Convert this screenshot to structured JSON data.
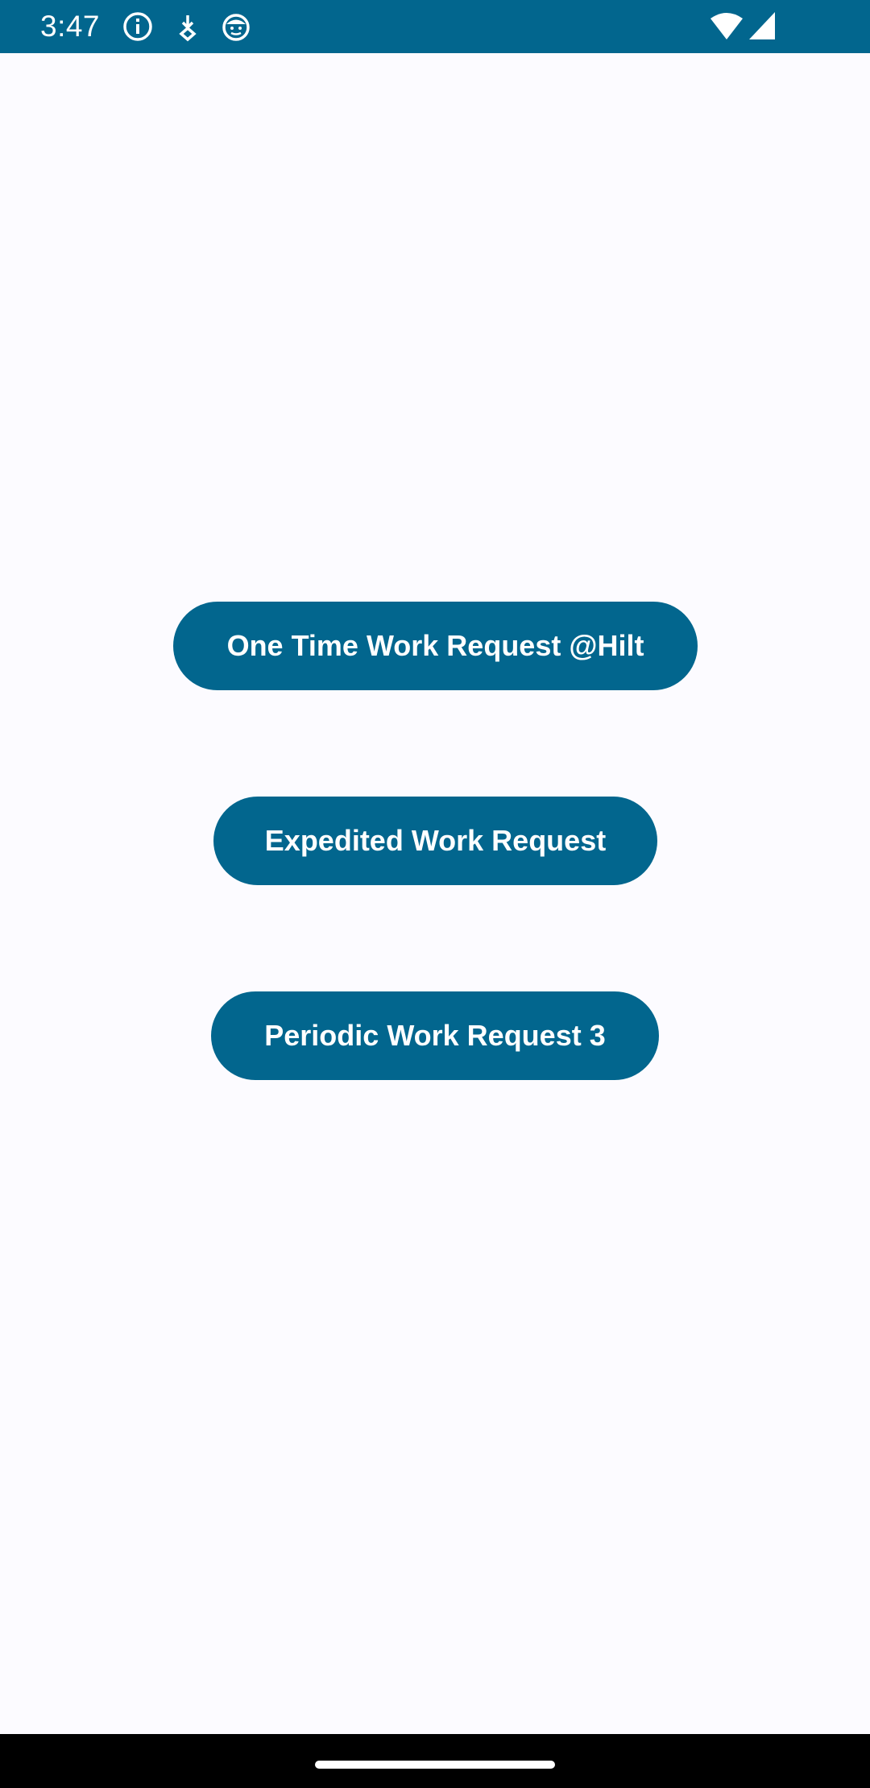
{
  "status_bar": {
    "time": "3:47",
    "icons": [
      "info-icon",
      "download-icon",
      "android-debug-icon",
      "wifi-icon",
      "signal-icon"
    ],
    "background_color": "#02668e"
  },
  "main": {
    "buttons": [
      {
        "label": "One Time Work Request @Hilt"
      },
      {
        "label": "Expedited Work Request"
      },
      {
        "label": "Periodic Work Request 3"
      }
    ],
    "button_color": "#02668e",
    "background_color": "#fcfbff"
  },
  "nav_bar": {
    "handle": "home-gesture-handle"
  }
}
